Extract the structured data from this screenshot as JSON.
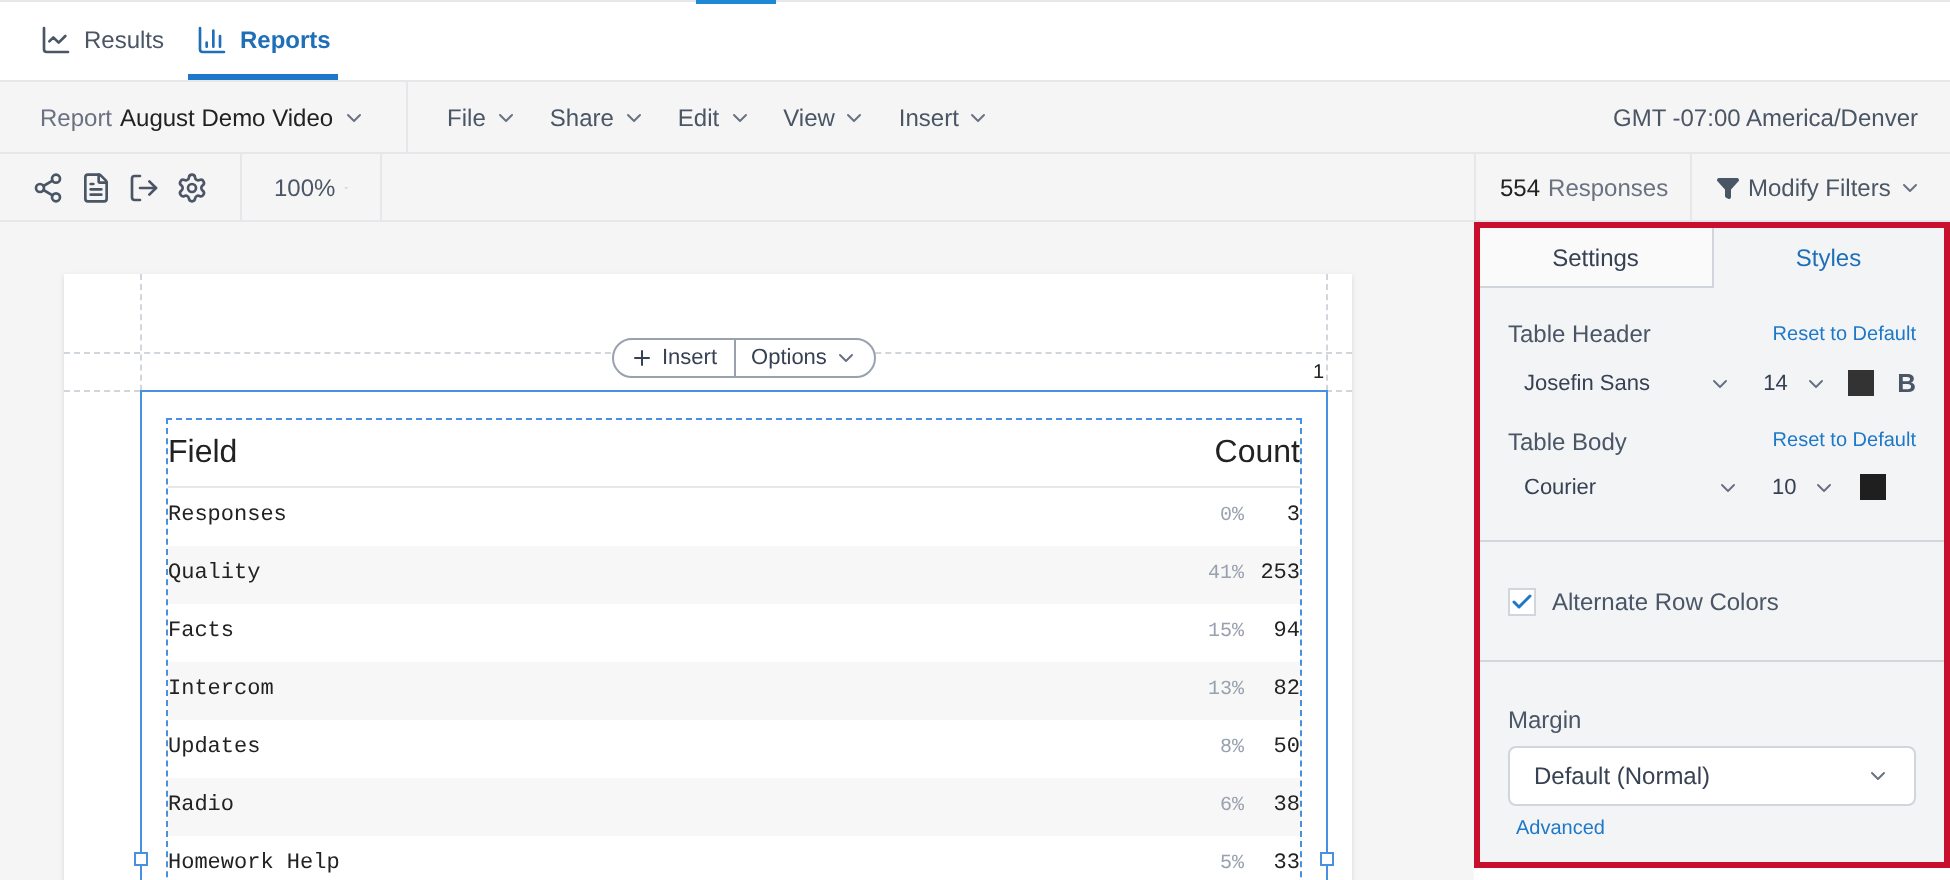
{
  "nav_tabs": [
    {
      "label": "Results",
      "kind": "results",
      "selected": false
    },
    {
      "label": "Reports",
      "kind": "reports",
      "selected": true
    }
  ],
  "menubar": {
    "report_prefix": "Report",
    "report_name": "August Demo Video",
    "menus": [
      "File",
      "Share",
      "Edit",
      "View",
      "Insert"
    ],
    "timezone": "GMT -07:00 America/Denver"
  },
  "toolbar": {
    "zoom": "100%",
    "responses_count": "554",
    "responses_label": "Responses",
    "filter_button": "Modify Filters"
  },
  "canvas": {
    "insert_button": "Insert",
    "options_button": "Options",
    "page_number": "1",
    "table": {
      "columns": [
        "Field",
        "Count"
      ],
      "rows": [
        {
          "field": "Responses",
          "percent": "0%",
          "count": "3"
        },
        {
          "field": "Quality",
          "percent": "41%",
          "count": "253"
        },
        {
          "field": "Facts",
          "percent": "15%",
          "count": "94"
        },
        {
          "field": "Intercom",
          "percent": "13%",
          "count": "82"
        },
        {
          "field": "Updates",
          "percent": "8%",
          "count": "50"
        },
        {
          "field": "Radio",
          "percent": "6%",
          "count": "38"
        },
        {
          "field": "Homework Help",
          "percent": "5%",
          "count": "33"
        }
      ]
    }
  },
  "panel": {
    "tabs": [
      {
        "label": "Settings",
        "selected": false
      },
      {
        "label": "Styles",
        "selected": true
      }
    ],
    "sections": [
      {
        "title": "Table Header",
        "reset": "Reset to Default",
        "font": "Josefin Sans",
        "size": "14",
        "color": "#333333",
        "bold_label": "B",
        "bold": true
      },
      {
        "title": "Table Body",
        "reset": "Reset to Default",
        "font": "Courier",
        "size": "10",
        "color": "#1f1f1f"
      }
    ],
    "alternate_row_colors": {
      "label": "Alternate Row Colors",
      "checked": true
    },
    "margin": {
      "label": "Margin",
      "value": "Default (Normal)",
      "link": "Advanced"
    }
  }
}
